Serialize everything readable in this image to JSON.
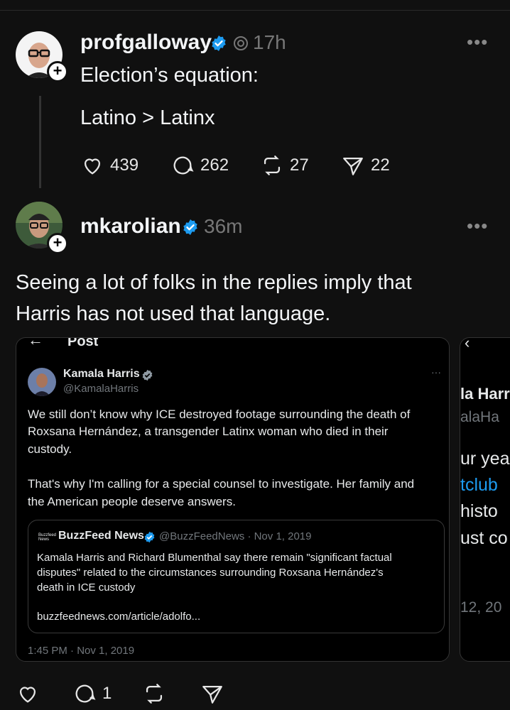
{
  "post1": {
    "username": "profgalloway",
    "time": "17h",
    "text_line1": "Election’s equation:",
    "text_line2": "Latino > Latinx",
    "likes": "439",
    "replies": "262",
    "reposts": "27",
    "shares": "22"
  },
  "post2": {
    "username": "mkarolian",
    "time": "36m",
    "text_line1": "Seeing a lot of folks in the replies imply that",
    "text_line2": "Harris has not used that language.",
    "replies": "1"
  },
  "embed": {
    "header": "Post",
    "name": "Kamala Harris",
    "handle": "@KamalaHarris",
    "body1_l1": "We still don’t know why ICE destroyed footage surrounding the death of",
    "body1_l2": "Roxsana Hernández, a transgender Latinx woman who died in their",
    "body1_l3": "custody.",
    "body2_l1": "That's why I'm calling for a special counsel to investigate. Her family and",
    "body2_l2": "the American people deserve answers.",
    "quote": {
      "name": "BuzzFeed News",
      "meta": "@BuzzFeedNews · Nov 1, 2019",
      "l1": "Kamala Harris and Richard Blumenthal say there remain \"significant factual",
      "l2": "disputes\" related to the circumstances surrounding Roxsana Hernández's",
      "l3": "death in ICE custody",
      "link": "buzzfeednews.com/article/adolfo..."
    },
    "timestamp": "1:45 PM · Nov 1, 2019"
  },
  "embed2": {
    "l1": "la Harr",
    "l2": "alaHa",
    "l3": "ur yea",
    "l4": "tclub",
    "l5": "histo",
    "l6": "ust co",
    "l7": "12, 20"
  },
  "colors": {
    "verified": "#1d9bf0",
    "background": "#101010",
    "muted": "#777777"
  }
}
